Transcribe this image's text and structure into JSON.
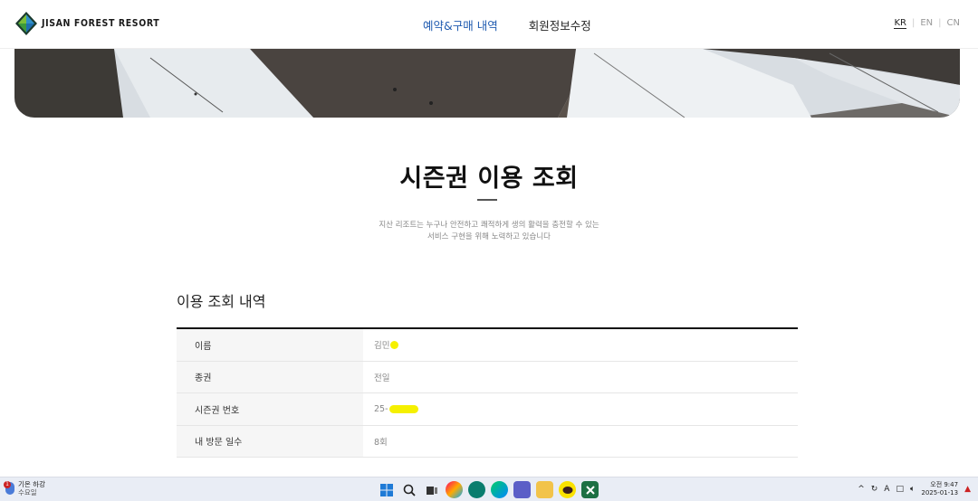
{
  "header": {
    "logo_text": "JISAN FOREST RESORT",
    "nav": [
      {
        "label": "예약&구매 내역",
        "active": true
      },
      {
        "label": "회원정보수정",
        "active": false
      }
    ],
    "languages": [
      "KR",
      "EN",
      "CN"
    ],
    "active_language": "KR"
  },
  "page": {
    "title": "시즌권 이용 조회",
    "subtitle_line1": "지산 리조트는 누구나 안전하고 쾌적하게 생의 활력을 충전할 수 있는",
    "subtitle_line2": "서비스 구현을 위해 노력하고 있습니다"
  },
  "section": {
    "title": "이용 조회 내역",
    "rows": [
      {
        "label": "이름",
        "value": "김민"
      },
      {
        "label": "종권",
        "value": "전일"
      },
      {
        "label": "시즌권 번호",
        "value": "25-"
      },
      {
        "label": "내 방문 일수",
        "value": "8회"
      }
    ]
  },
  "taskbar": {
    "weather_title": "기온 하강",
    "weather_sub": "수요일",
    "weather_badge": "1",
    "tray_lang": "A",
    "time": "오전 9:47",
    "date": "2025-01-13"
  },
  "colors": {
    "accent": "#1f5bb0",
    "mask": "#f5f000"
  }
}
